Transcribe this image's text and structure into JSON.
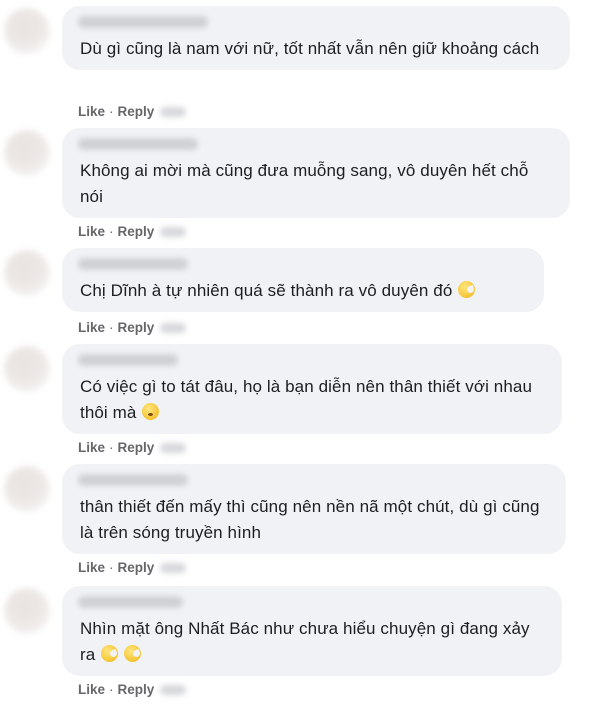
{
  "comments": [
    {
      "text": "Dù gì cũng là nam với nữ, tốt nhất vẫn nên giữ khoảng cách",
      "actions": {
        "like": "Like",
        "reply": "Reply"
      }
    },
    {
      "text": "Không ai mời mà cũng đưa muỗng sang, vô duyên hết chỗ nói",
      "actions": {
        "like": "Like",
        "reply": "Reply"
      }
    },
    {
      "text": "Chị Dĩnh à tự nhiên quá sẽ thành ra vô duyên đó",
      "emoji": "yum-icon",
      "actions": {
        "like": "Like",
        "reply": "Reply"
      }
    },
    {
      "text": "Có việc gì to tát đâu, họ là bạn diễn nên thân thiết với nhau thôi mà",
      "emoji": "worried-icon",
      "actions": {
        "like": "Like",
        "reply": "Reply"
      }
    },
    {
      "text": "thân thiết đến mấy thì cũng nên nền nã một chút, dù gì cũng là trên sóng truyền hình",
      "actions": {
        "like": "Like",
        "reply": "Reply"
      }
    },
    {
      "text": "Nhìn mặt ông Nhất Bác như chưa hiểu chuyện gì đang xảy ra",
      "emoji": "yum-icon",
      "emoji2": "yum-icon",
      "actions": {
        "like": "Like",
        "reply": "Reply"
      }
    }
  ],
  "separator": "·"
}
